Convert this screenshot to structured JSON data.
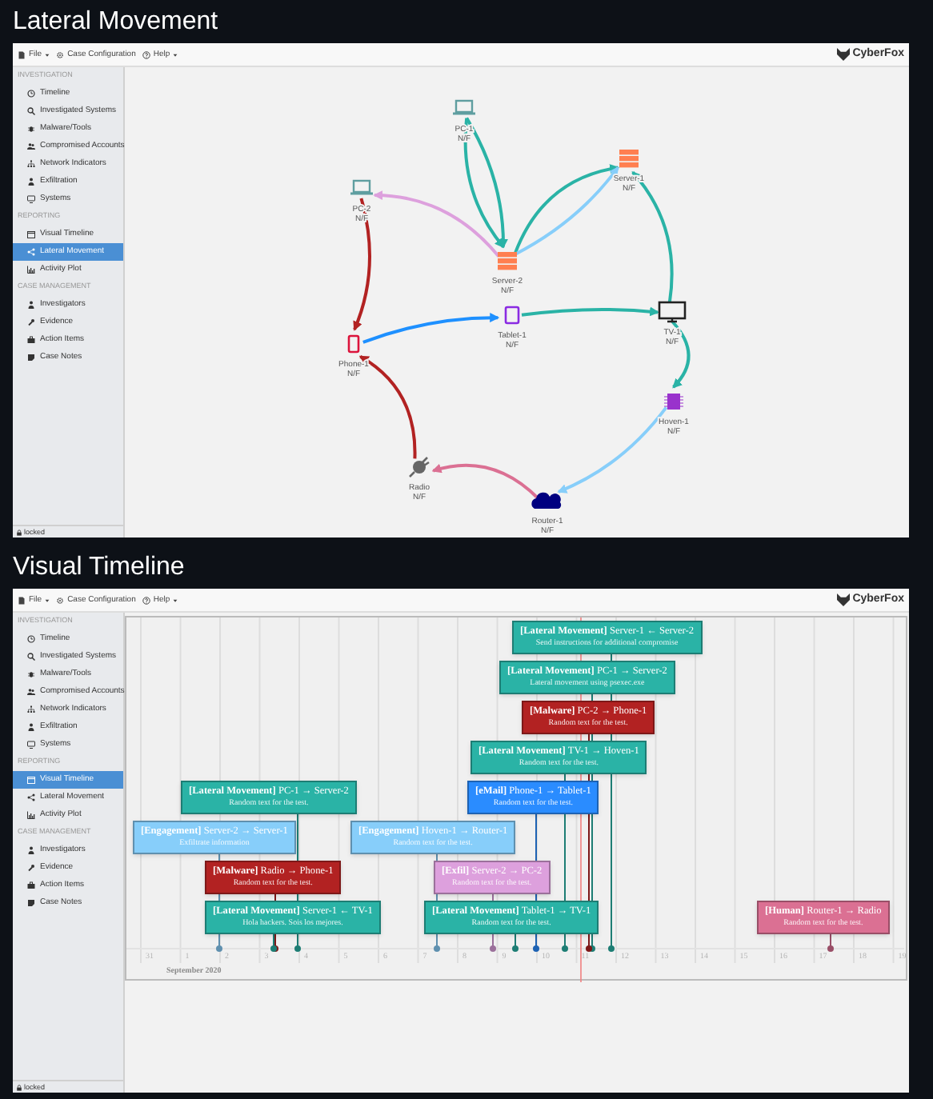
{
  "views": [
    {
      "heading": "Lateral Movement",
      "menu": [
        {
          "label": "File",
          "dropdown": true
        },
        {
          "label": "Case Configuration",
          "dropdown": false
        },
        {
          "label": "Help",
          "dropdown": true
        }
      ],
      "logo": "CyberFox",
      "sidebar": [
        {
          "title": "INVESTIGATION",
          "items": [
            {
              "label": "Timeline",
              "selected": false
            },
            {
              "label": "Investigated Systems",
              "selected": false
            },
            {
              "label": "Malware/Tools",
              "selected": false
            },
            {
              "label": "Compromised Accounts",
              "selected": false
            },
            {
              "label": "Network Indicators",
              "selected": false
            },
            {
              "label": "Exfiltration",
              "selected": false
            },
            {
              "label": "Systems",
              "selected": false
            }
          ]
        },
        {
          "title": "REPORTING",
          "items": [
            {
              "label": "Visual Timeline",
              "selected": false
            },
            {
              "label": "Lateral Movement",
              "selected": true
            },
            {
              "label": "Activity Plot",
              "selected": false
            }
          ]
        },
        {
          "title": "CASE MANAGEMENT",
          "items": [
            {
              "label": "Investigators",
              "selected": false
            },
            {
              "label": "Evidence",
              "selected": false
            },
            {
              "label": "Action Items",
              "selected": false
            },
            {
              "label": "Case Notes",
              "selected": false
            }
          ]
        }
      ],
      "footer": "locked",
      "content": {
        "kind": "graph",
        "nodes": [
          {
            "label": "PC-1",
            "status": "N/F",
            "kind": "pc"
          },
          {
            "label": "Server-1",
            "status": "N/F",
            "kind": "server"
          },
          {
            "label": "PC-2",
            "status": "N/F",
            "kind": "pc"
          },
          {
            "label": "Server-2",
            "status": "N/F",
            "kind": "server"
          },
          {
            "label": "Tablet-1",
            "status": "N/F",
            "kind": "tablet"
          },
          {
            "label": "TV-1",
            "status": "N/F",
            "kind": "tv"
          },
          {
            "label": "Phone-1",
            "status": "N/F",
            "kind": "phone"
          },
          {
            "label": "Hoven-1",
            "status": "N/F",
            "kind": "iot"
          },
          {
            "label": "Radio",
            "status": "N/F",
            "kind": "radio"
          },
          {
            "label": "Router-1",
            "status": "N/F",
            "kind": "router"
          }
        ],
        "edges": [
          {
            "color": "#2ab3a6"
          },
          {
            "color": "#2ab3a6"
          },
          {
            "color": "#2ab3a6"
          },
          {
            "color": "#87cefa"
          },
          {
            "color": "#dda0dd"
          },
          {
            "color": "#b22222"
          },
          {
            "color": "#b22222"
          },
          {
            "color": "#1e90ff"
          },
          {
            "color": "#2ab3a6"
          },
          {
            "color": "#2ab3a6"
          },
          {
            "color": "#2ab3a6"
          },
          {
            "color": "#87cefa"
          },
          {
            "color": "#db7093"
          }
        ]
      }
    },
    {
      "heading": "Visual Timeline",
      "menu": [
        {
          "label": "File",
          "dropdown": true
        },
        {
          "label": "Case Configuration",
          "dropdown": false
        },
        {
          "label": "Help",
          "dropdown": true
        }
      ],
      "logo": "CyberFox",
      "sidebar": [
        {
          "title": "INVESTIGATION",
          "items": [
            {
              "label": "Timeline",
              "selected": false
            },
            {
              "label": "Investigated Systems",
              "selected": false
            },
            {
              "label": "Malware/Tools",
              "selected": false
            },
            {
              "label": "Compromised Accounts",
              "selected": false
            },
            {
              "label": "Network Indicators",
              "selected": false
            },
            {
              "label": "Exfiltration",
              "selected": false
            },
            {
              "label": "Systems",
              "selected": false
            }
          ]
        },
        {
          "title": "REPORTING",
          "items": [
            {
              "label": "Visual Timeline",
              "selected": true
            },
            {
              "label": "Lateral Movement",
              "selected": false
            },
            {
              "label": "Activity Plot",
              "selected": false
            }
          ]
        },
        {
          "title": "CASE MANAGEMENT",
          "items": [
            {
              "label": "Investigators",
              "selected": false
            },
            {
              "label": "Evidence",
              "selected": false
            },
            {
              "label": "Action Items",
              "selected": false
            },
            {
              "label": "Case Notes",
              "selected": false
            }
          ]
        }
      ],
      "footer": "locked",
      "content": {
        "kind": "timeline",
        "events": [
          {
            "headline": "**[Lateral Movement]** Server-1 ← Server-2",
            "description": "Send instructions for additional compromise",
            "color": "#2ab3a6"
          },
          {
            "headline": "**[Lateral Movement]** PC-1 → Server-2",
            "description": "Lateral movement using psexec.exe",
            "color": "#2ab3a6"
          },
          {
            "headline": "**[Malware]** PC-2 → Phone-1",
            "description": "Random text for the test.",
            "color": "#b22222"
          },
          {
            "headline": "**[Lateral Movement]** TV-1 → Hoven-1",
            "description": "Random text for the test.",
            "color": "#2ab3a6"
          },
          {
            "headline": "**[Lateral Movement]** PC-1 → Server-2",
            "description": "Random text for the test.",
            "color": "#2ab3a6"
          },
          {
            "headline": "**[eMail]** Phone-1 → Tablet-1",
            "description": "Random text for the test.",
            "color": "#2a8cff"
          },
          {
            "headline": "**[Engagement]** Server-2 → Server-1",
            "description": "Exfiltrate information",
            "color": "#87cefa"
          },
          {
            "headline": "**[Engagement]** Hoven-1 → Router-1",
            "description": "Random text for the test.",
            "color": "#87cefa"
          },
          {
            "headline": "**[Malware]** Radio → Phone-1",
            "description": "Random text for the test.",
            "color": "#b22222"
          },
          {
            "headline": "**[Exfil]** Server-2 → PC-2",
            "description": "Random text for the test.",
            "color": "#dda0dd"
          },
          {
            "headline": "**[Lateral Movement]** Server-1 ← TV-1",
            "description": "Hola hackers. Sois los mejores.",
            "color": "#2ab3a6"
          },
          {
            "headline": "**[Lateral Movement]** Tablet-1 → TV-1",
            "description": "Random text for the test.",
            "color": "#2ab3a6"
          },
          {
            "headline": "**[Human]** Router-1 → Radio",
            "description": "Random text for the test.",
            "color": "#db7093"
          }
        ],
        "ticks": [
          "31",
          "1",
          "2",
          "3",
          "4",
          "5",
          "6",
          "7",
          "8",
          "9",
          "10",
          "11",
          "12",
          "13",
          "14",
          "15",
          "16",
          "17",
          "18",
          "19"
        ],
        "month": "September 2020"
      }
    }
  ]
}
